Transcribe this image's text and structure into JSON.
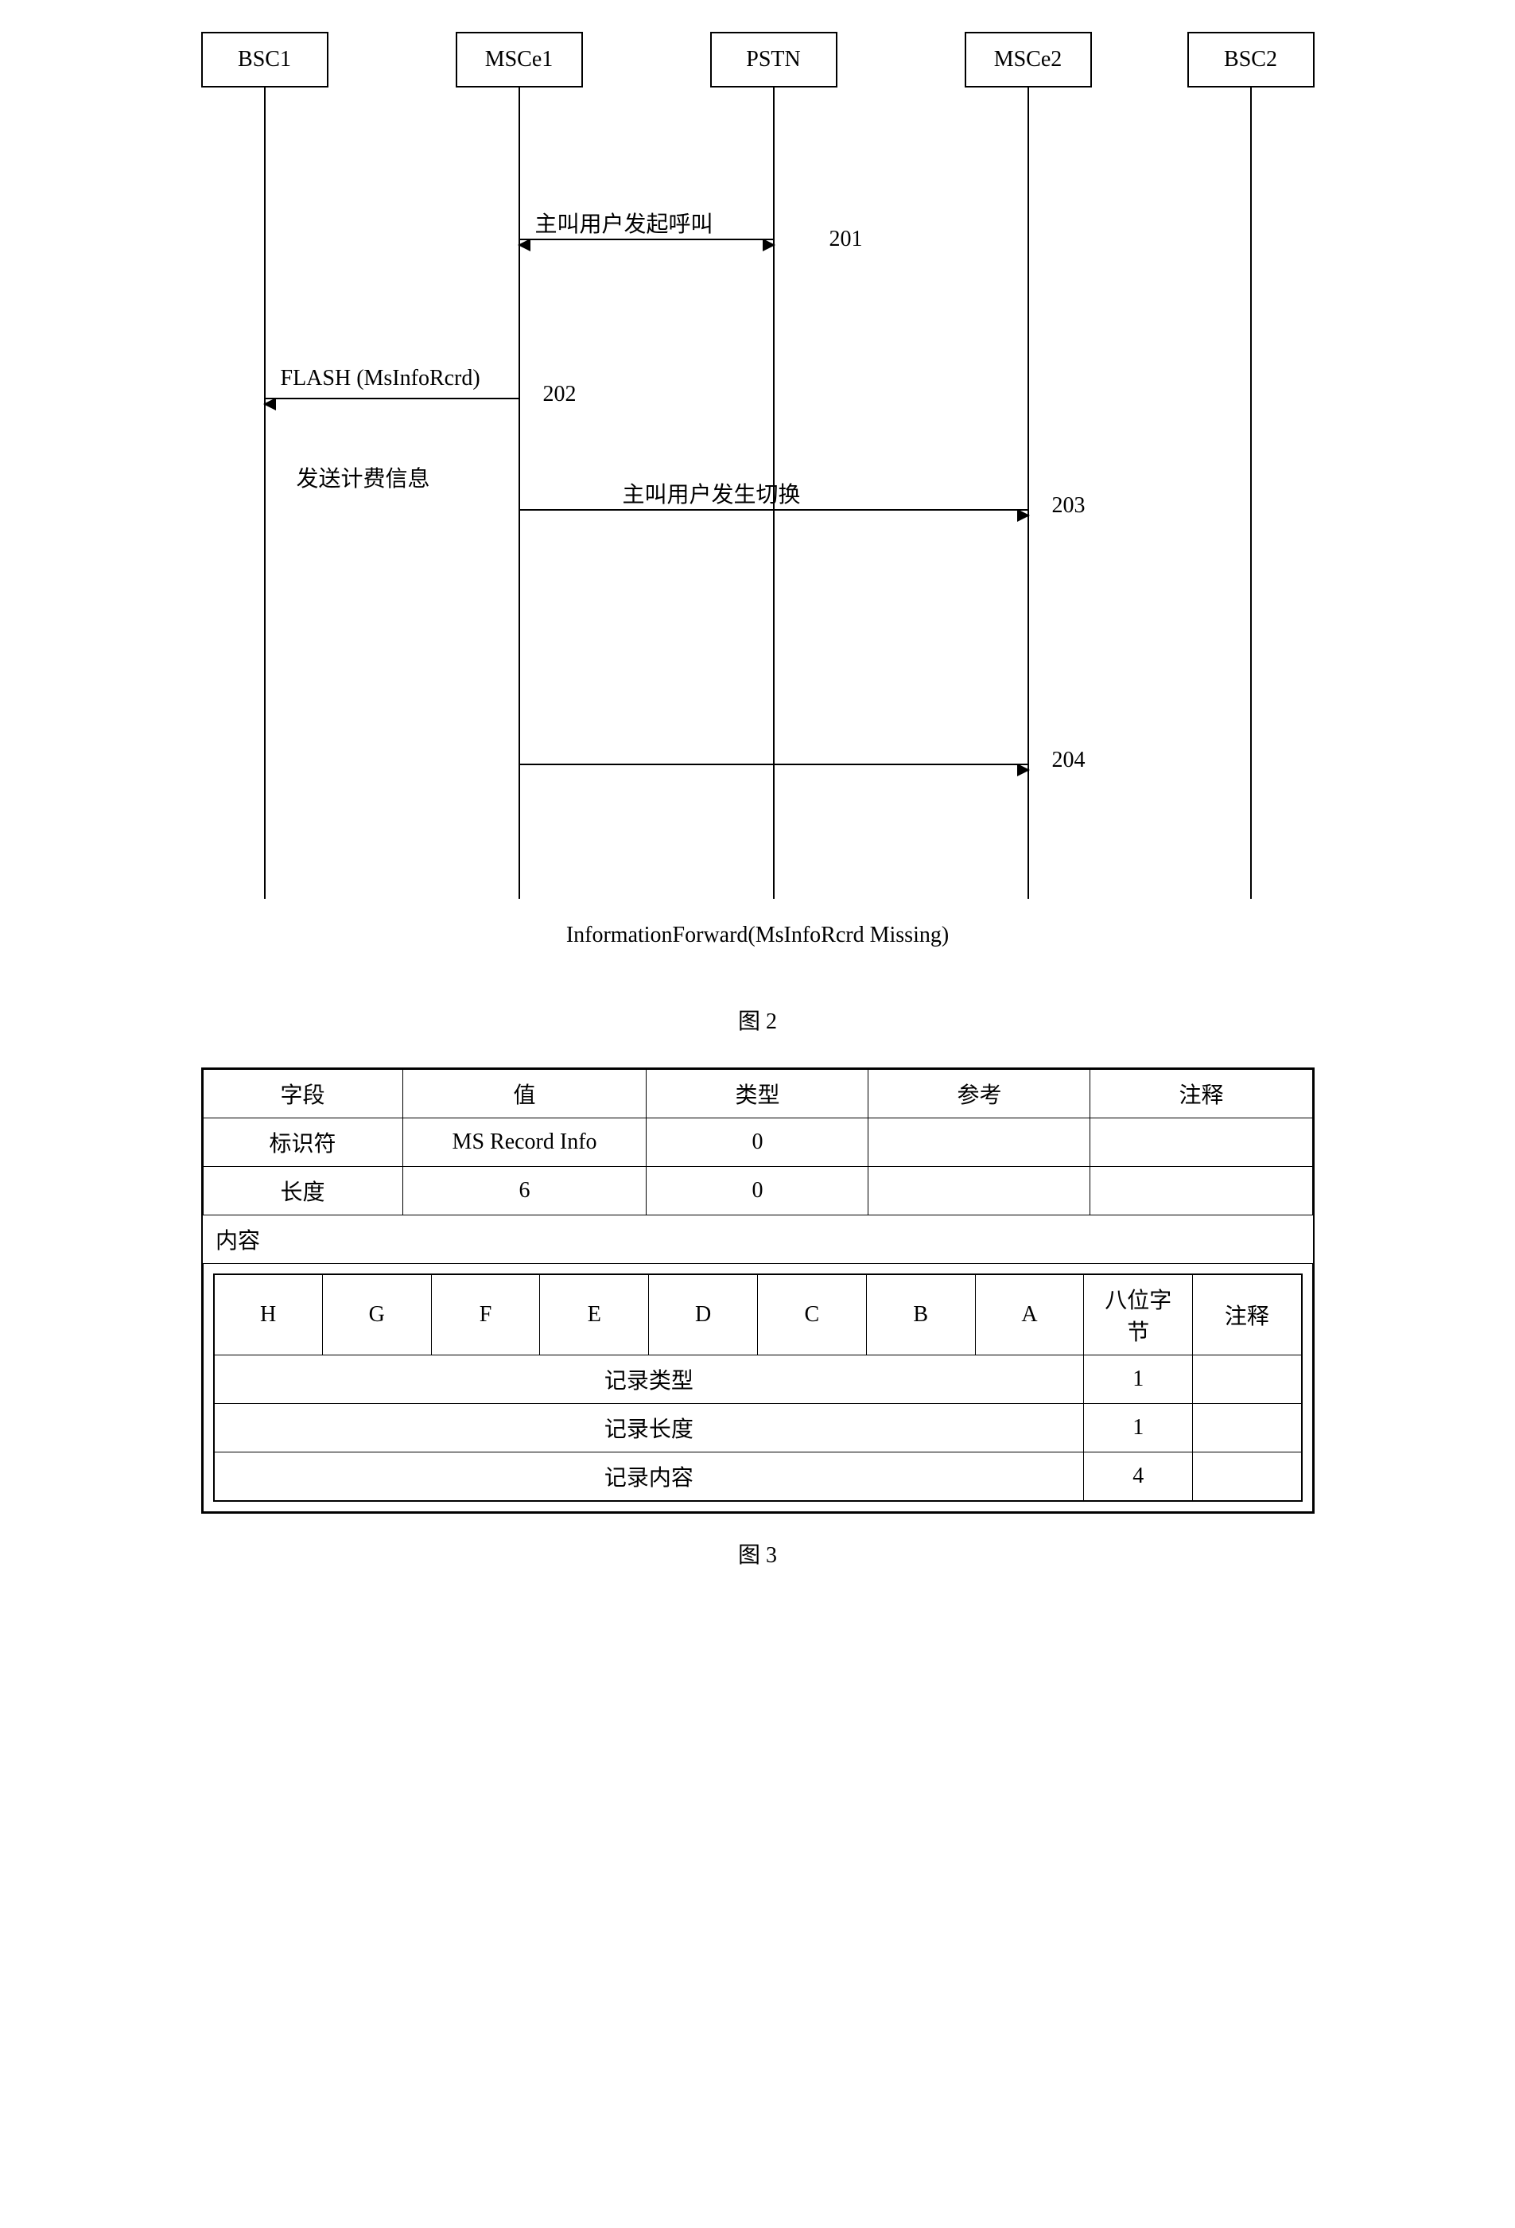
{
  "diagram": {
    "actors": [
      "BSC1",
      "MSCe1",
      "PSTN",
      "MSCe2",
      "BSC2"
    ],
    "messages": {
      "m201": "主叫用户发起呼叫",
      "m202_flash": "FLASH (MsInfoRcrd)",
      "m202_sub": "发送计费信息",
      "m203": "主叫用户发生切换"
    },
    "steps": {
      "s201": "201",
      "s202": "202",
      "s203": "203",
      "s204": "204"
    },
    "footer_note": "InformationForward(MsInfoRcrd Missing)",
    "caption2": "图 2"
  },
  "table_top": {
    "headers": [
      "字段",
      "值",
      "类型",
      "参考",
      "注释"
    ],
    "rows": [
      [
        "标识符",
        "MS Record Info",
        "0",
        "",
        ""
      ],
      [
        "长度",
        "6",
        "0",
        "",
        ""
      ]
    ],
    "content_label": "内容"
  },
  "table_inner": {
    "bit_headers": [
      "H",
      "G",
      "F",
      "E",
      "D",
      "C",
      "B",
      "A"
    ],
    "octet_label": "八位字节",
    "note_label": "注释",
    "rows": [
      {
        "label": "记录类型",
        "octet": "1",
        "note": ""
      },
      {
        "label": "记录长度",
        "octet": "1",
        "note": ""
      },
      {
        "label": "记录内容",
        "octet": "4",
        "note": ""
      }
    ]
  },
  "caption3": "图 3",
  "chart_data": {
    "type": "table",
    "figure2_sequence": {
      "participants": [
        "BSC1",
        "MSCe1",
        "PSTN",
        "MSCe2",
        "BSC2"
      ],
      "interactions": [
        {
          "step": 201,
          "from": "MSCe1",
          "to": "PSTN",
          "direction": "bidirectional",
          "label": "主叫用户发起呼叫"
        },
        {
          "step": 202,
          "from": "MSCe1",
          "to": "BSC1",
          "direction": "left",
          "label": "FLASH (MsInfoRcrd)",
          "sub_label": "发送计费信息"
        },
        {
          "step": 203,
          "from": "MSCe1",
          "to": "MSCe2",
          "direction": "right",
          "label": "主叫用户发生切换"
        },
        {
          "step": 204,
          "from": "MSCe1",
          "to": "MSCe2",
          "direction": "right",
          "label": "InformationForward(MsInfoRcrd Missing)"
        }
      ]
    },
    "figure3_table": {
      "top": [
        {
          "字段": "标识符",
          "值": "MS Record Info",
          "类型": 0
        },
        {
          "字段": "长度",
          "值": 6,
          "类型": 0
        }
      ],
      "content_bits": [
        "H",
        "G",
        "F",
        "E",
        "D",
        "C",
        "B",
        "A"
      ],
      "content_rows": [
        {
          "名称": "记录类型",
          "八位字节": 1
        },
        {
          "名称": "记录长度",
          "八位字节": 1
        },
        {
          "名称": "记录内容",
          "八位字节": 4
        }
      ]
    }
  }
}
